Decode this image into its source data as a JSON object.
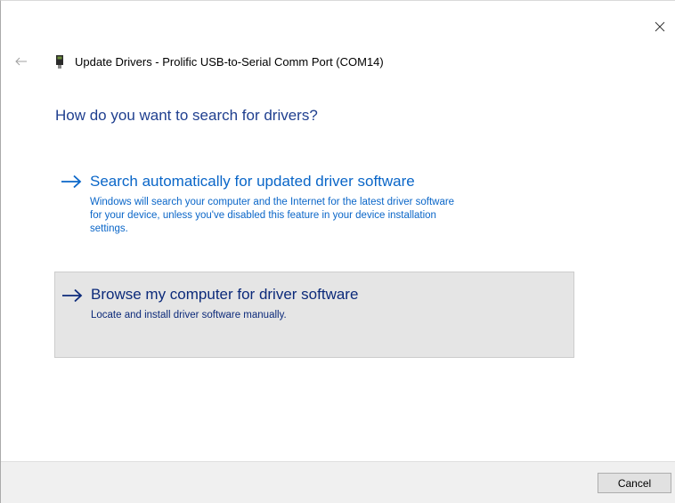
{
  "window": {
    "title": "Update Drivers - Prolific USB-to-Serial Comm Port (COM14)"
  },
  "question": "How do you want to search for drivers?",
  "options": [
    {
      "title": "Search automatically for updated driver software",
      "description": "Windows will search your computer and the Internet for the latest driver software\nfor your device, unless you've disabled this feature in your device installation\nsettings."
    },
    {
      "title": "Browse my computer for driver software",
      "description": "Locate and install driver software manually."
    }
  ],
  "footer": {
    "cancel_label": "Cancel"
  },
  "icons": {
    "close": "close-icon",
    "back": "back-arrow-icon",
    "device": "usb-device-icon",
    "option_arrow": "arrow-right-icon"
  },
  "colors": {
    "question": "#1f3f8f",
    "link": "#0a66c8",
    "link_hover": "#0c2a7a",
    "hover_background": "#e5e5e5",
    "footer_background": "#f0f0f0"
  }
}
